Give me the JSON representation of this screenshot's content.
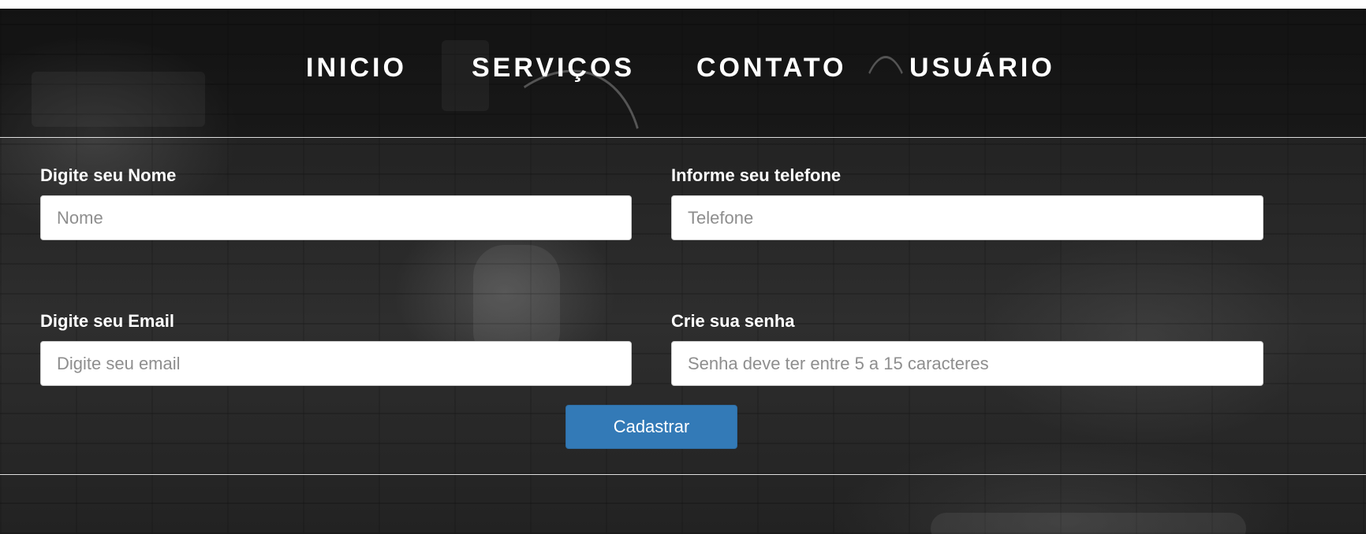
{
  "nav": {
    "items": [
      {
        "label": "INICIO"
      },
      {
        "label": "SERVIÇOS"
      },
      {
        "label": "CONTATO"
      },
      {
        "label": "USUÁRIO"
      }
    ]
  },
  "form": {
    "nome": {
      "label": "Digite seu Nome",
      "placeholder": "Nome",
      "value": ""
    },
    "telefone": {
      "label": "Informe seu telefone",
      "placeholder": "Telefone",
      "value": ""
    },
    "email": {
      "label": "Digite seu Email",
      "placeholder": "Digite seu email",
      "value": ""
    },
    "senha": {
      "label": "Crie sua senha",
      "placeholder": "Senha deve ter entre 5 a 15 caracteres",
      "value": ""
    },
    "submit_label": "Cadastrar"
  },
  "colors": {
    "button_primary": "#337ab7",
    "text_on_dark": "#ffffff"
  }
}
